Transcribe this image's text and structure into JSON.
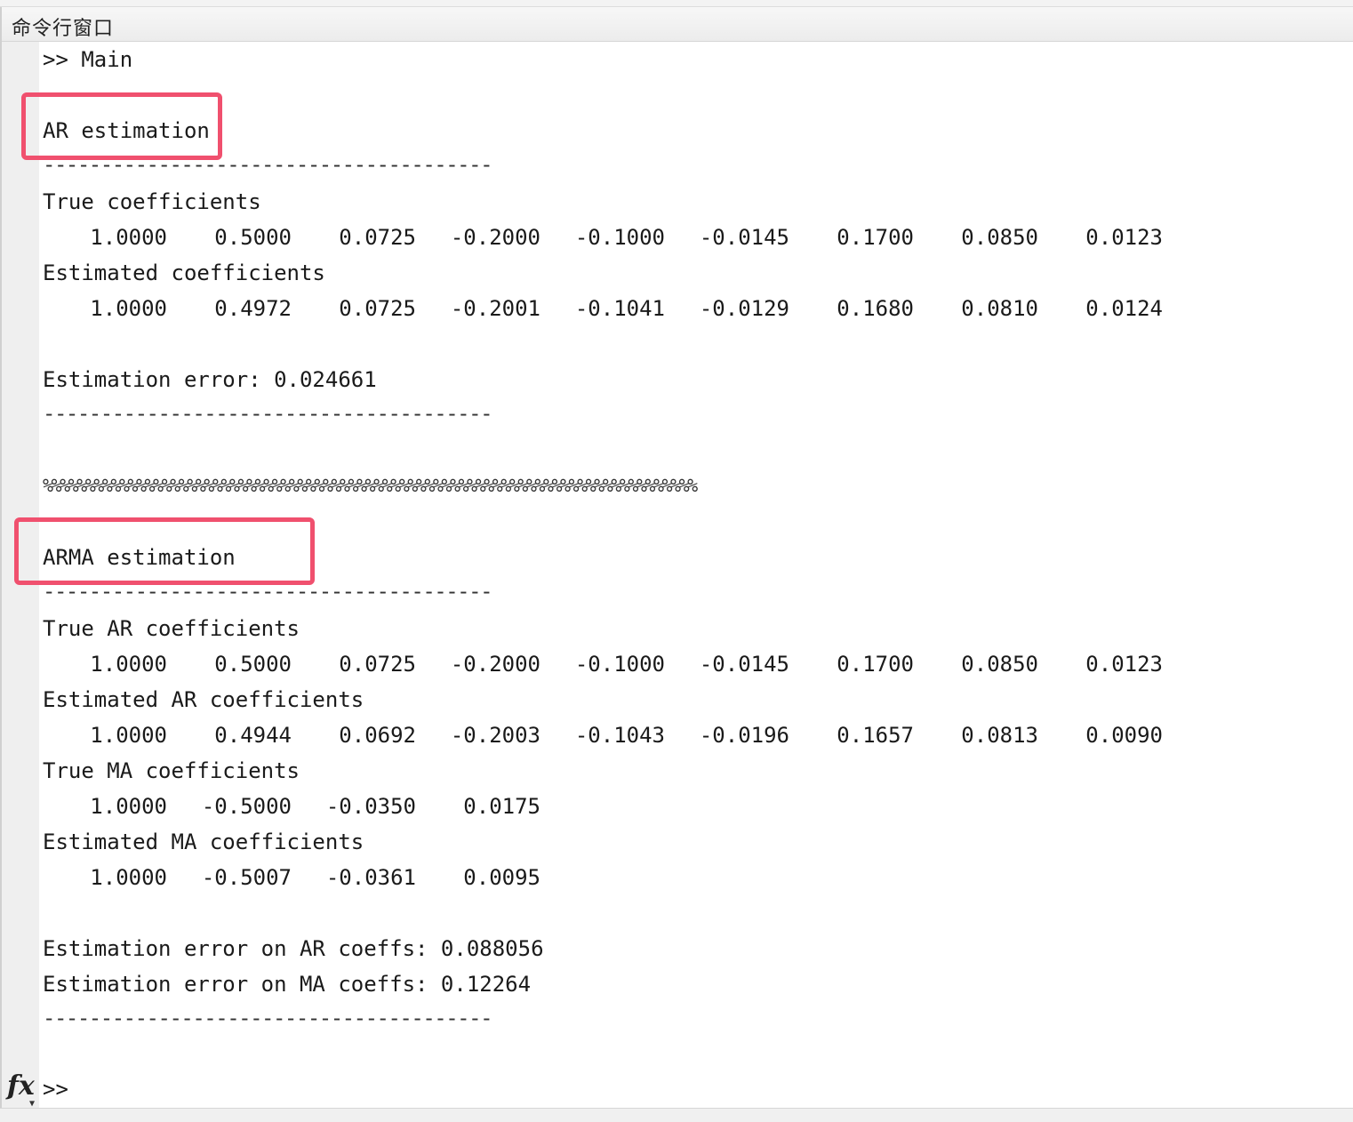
{
  "window": {
    "title": "命令行窗口"
  },
  "console": {
    "command_line": ">> Main",
    "ar": {
      "heading": "AR estimation",
      "separator": "---------------------------------------",
      "true_label": "True coefficients",
      "true_values": [
        "1.0000",
        "0.5000",
        "0.0725",
        "-0.2000",
        "-0.1000",
        "-0.0145",
        "0.1700",
        "0.0850",
        "0.0123"
      ],
      "est_label": "Estimated coefficients",
      "est_values": [
        "1.0000",
        "0.4972",
        "0.0725",
        "-0.2001",
        "-0.1041",
        "-0.0129",
        "0.1680",
        "0.0810",
        "0.0124"
      ],
      "error_line": "Estimation error: 0.024661",
      "separator_end": "---------------------------------------"
    },
    "percent_line": "%%%%%%%%%%%%%%%%%%%%%%%%%%%%%%%%%%%%%%%%%%%%%%%%%%%%%%%%%%%%%%%%%%%%%%%%%%%%%",
    "arma": {
      "heading": "ARMA estimation",
      "separator": "---------------------------------------",
      "true_ar_label": "True AR coefficients",
      "true_ar_values": [
        "1.0000",
        "0.5000",
        "0.0725",
        "-0.2000",
        "-0.1000",
        "-0.0145",
        "0.1700",
        "0.0850",
        "0.0123"
      ],
      "est_ar_label": "Estimated AR coefficients",
      "est_ar_values": [
        "1.0000",
        "0.4944",
        "0.0692",
        "-0.2003",
        "-0.1043",
        "-0.0196",
        "0.1657",
        "0.0813",
        "0.0090"
      ],
      "true_ma_label": "True MA coefficients",
      "true_ma_values": [
        "1.0000",
        "-0.5000",
        "-0.0350",
        "0.0175"
      ],
      "est_ma_label": "Estimated MA coefficients",
      "est_ma_values": [
        "1.0000",
        "-0.5007",
        "-0.0361",
        "0.0095"
      ],
      "error_ar_line": "Estimation error on AR coeffs: 0.088056",
      "error_ma_line": "Estimation error on MA coeffs: 0.12264",
      "separator_end": "---------------------------------------"
    },
    "prompt": ">>",
    "fx_icon": "fx-icon"
  },
  "colors": {
    "highlight": "#f0506e",
    "gutter": "#efefef"
  }
}
